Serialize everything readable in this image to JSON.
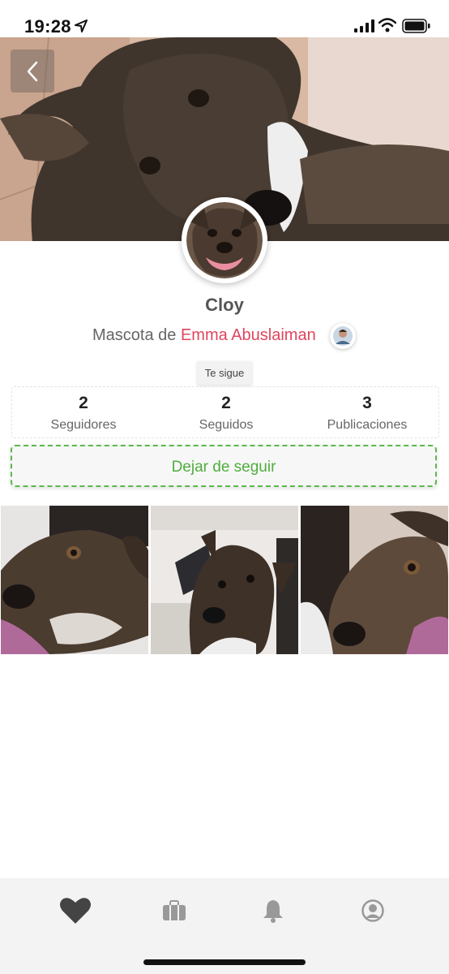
{
  "status_bar": {
    "time": "19:28",
    "icons": [
      "location-arrow-icon",
      "signal-icon",
      "wifi-icon",
      "battery-icon"
    ]
  },
  "header": {
    "back_icon": "chevron-left-icon"
  },
  "profile": {
    "name": "Cloy",
    "owner_prefix": "Mascota de",
    "owner_name": "Emma Abuslaiman",
    "follows_you_badge": "Te sigue"
  },
  "stats": [
    {
      "value": "2",
      "label": "Seguidores"
    },
    {
      "value": "2",
      "label": "Seguidos"
    },
    {
      "value": "3",
      "label": "Publicaciones"
    }
  ],
  "actions": {
    "unfollow_label": "Dejar de seguir"
  },
  "tab_bar": {
    "tabs": [
      "heart-icon",
      "briefcase-icon",
      "bell-icon",
      "user-icon"
    ]
  },
  "colors": {
    "accent_red": "#e0455e",
    "accent_green": "#4fae3e"
  }
}
